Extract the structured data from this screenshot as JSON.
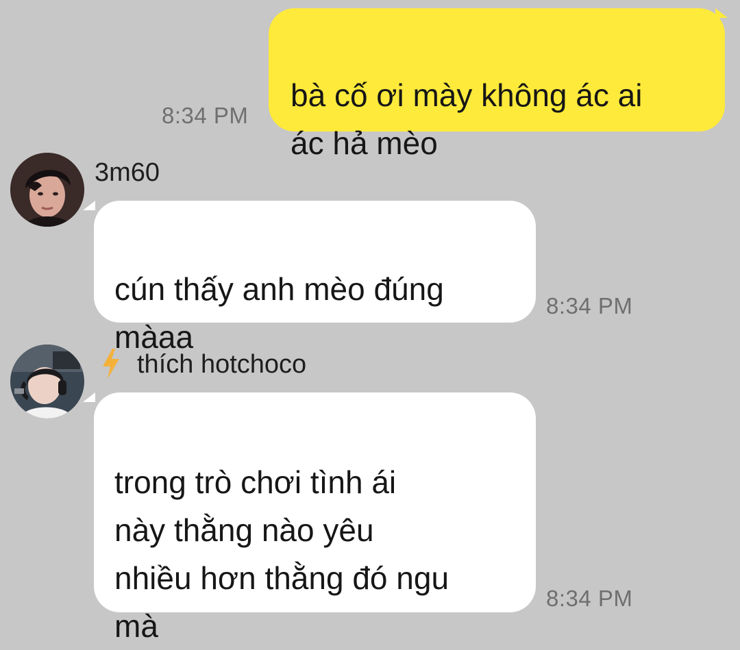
{
  "messages": [
    {
      "direction": "outgoing",
      "text": "bà cố ơi mày không ác ai\nác hả mèo",
      "time": "8:34 PM"
    },
    {
      "direction": "incoming",
      "sender": "3m60",
      "avatar_icon": "avatar-3m60",
      "text": "cún thấy anh mèo đúng\nmàaa",
      "time": "8:34 PM"
    },
    {
      "direction": "incoming",
      "sender": "thích hotchoco",
      "sender_icon": "lightning-bolt-icon",
      "avatar_icon": "avatar-hotchoco",
      "text": "trong trò chơi tình ái\nnày thằng nào yêu\nnhiều hơn thằng đó ngu\nmà",
      "time": "8:34 PM"
    }
  ],
  "colors": {
    "background": "#c7c7c7",
    "outgoing_bubble": "#feea3b",
    "incoming_bubble": "#ffffff",
    "timestamp": "#6f6f6f",
    "bolt": "#f4b13a"
  }
}
